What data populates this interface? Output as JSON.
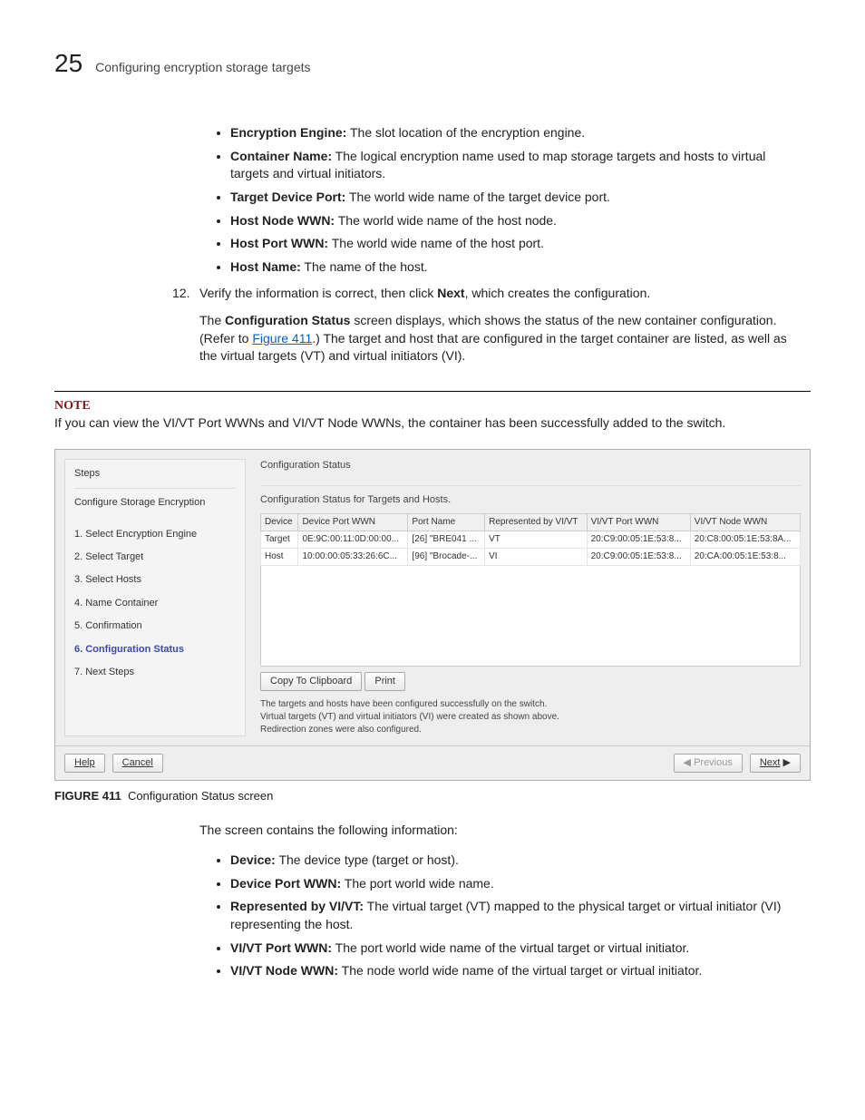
{
  "header": {
    "page_number": "25",
    "title": "Configuring encryption storage targets"
  },
  "bullets_top": [
    {
      "term": "Encryption Engine:",
      "desc": " The slot location of the encryption engine."
    },
    {
      "term": "Container Name:",
      "desc": " The logical encryption name used to map storage targets and hosts to virtual targets and virtual initiators."
    },
    {
      "term": "Target Device Port:",
      "desc": " The world wide name of the target device port."
    },
    {
      "term": "Host Node WWN:",
      "desc": " The world wide name of the host node."
    },
    {
      "term": "Host Port WWN:",
      "desc": " The world wide name of the host port."
    },
    {
      "term": "Host Name:",
      "desc": " The name of the host."
    }
  ],
  "step12": {
    "num": "12.",
    "line1_pre": "Verify the information is correct, then click ",
    "line1_bold": "Next",
    "line1_post": ", which creates the configuration.",
    "para_pre": "The ",
    "para_bold": "Configuration Status",
    "para_mid": " screen displays, which shows the status of the new container configuration. (Refer to ",
    "para_link": "Figure 411",
    "para_post": ".) The target and host that are configured in the target container are listed, as well as the virtual targets (VT) and virtual initiators (VI)."
  },
  "note": {
    "label": "NOTE",
    "text": "If you can view the VI/VT Port WWNs and VI/VT Node WWNs, the container has been successfully added to the switch."
  },
  "sshot": {
    "steps_label": "Steps",
    "wizard_title": "Configure Storage Encryption",
    "steps": [
      "1. Select Encryption Engine",
      "2. Select Target",
      "3. Select Hosts",
      "4. Name Container",
      "5. Confirmation",
      "6. Configuration Status",
      "7. Next Steps"
    ],
    "active_step_index": 5,
    "right_title": "Configuration Status",
    "right_sub": "Configuration Status for Targets and Hosts.",
    "cols": [
      "Device",
      "Device Port WWN",
      "Port Name",
      "Represented by VI/VT",
      "VI/VT Port WWN",
      "VI/VT Node WWN"
    ],
    "rows": [
      [
        "Target",
        "0E:9C:00:11:0D:00:00...",
        "[26] \"BRE041 ...",
        "VT",
        "20:C9:00:05:1E:53:8...",
        "20:C8:00:05:1E:53:8A..."
      ],
      [
        "Host",
        "10:00:00:05:33:26:6C...",
        "[96] \"Brocade-...",
        "VI",
        "20:C9:00:05:1E:53:8...",
        "20:CA:00:05:1E:53:8..."
      ]
    ],
    "btn_copy": "Copy To Clipboard",
    "btn_print": "Print",
    "msg1": "The targets and hosts have been configured successfully on the switch.",
    "msg2": "Virtual targets (VT) and virtual initiators (VI) were created as shown above.",
    "msg3": "Redirection zones were also configured.",
    "btn_help": "Help",
    "btn_cancel": "Cancel",
    "btn_prev": "Previous",
    "btn_next": "Next"
  },
  "figure": {
    "label": "FIGURE 411",
    "caption": "Configuration Status screen"
  },
  "intro_after_fig": "The screen contains the following information:",
  "bullets_bottom": [
    {
      "term": "Device:",
      "desc": " The device type (target or host)."
    },
    {
      "term": "Device Port WWN:",
      "desc": " The port world wide name."
    },
    {
      "term": "Represented by VI/VT:",
      "desc": " The virtual target (VT) mapped to the physical target or virtual initiator (VI) representing the host."
    },
    {
      "term": "VI/VT Port WWN:",
      "desc": " The port world wide name of the virtual target or virtual initiator."
    },
    {
      "term": "VI/VT Node WWN:",
      "desc": " The node world wide name of the virtual target or virtual initiator."
    }
  ]
}
